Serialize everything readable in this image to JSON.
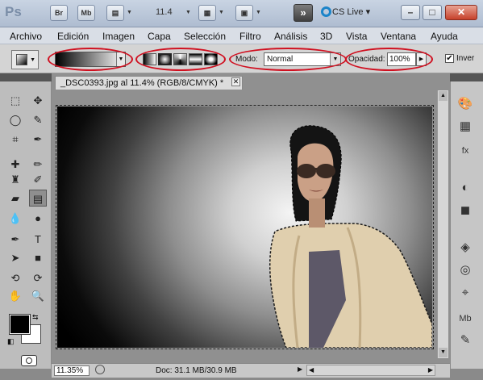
{
  "titlebar": {
    "app_logo": "Ps",
    "bridge_label": "Br",
    "minibridge_label": "Mb",
    "zoom_value": "11.4",
    "extensions_label": "»",
    "cslive_label": "CS Live",
    "cslive_arrow": "▾",
    "minimize_glyph": "–",
    "restore_glyph": "□",
    "close_glyph": "✕"
  },
  "menu": {
    "items": [
      "Archivo",
      "Edición",
      "Imagen",
      "Capa",
      "Selección",
      "Filtro",
      "Análisis",
      "3D",
      "Vista",
      "Ventana",
      "Ayuda"
    ]
  },
  "options": {
    "gradient_types": [
      "lineal",
      "radial",
      "angular",
      "reflejado",
      "diamante"
    ],
    "selected_gradient_type": "radial",
    "mode_label": "Modo:",
    "mode_value": "Normal",
    "opacity_label": "Opacidad:",
    "opacity_value": "100%",
    "invert_checked": true,
    "invert_label": "Inver"
  },
  "document": {
    "tab_title": "_DSC0393.jpg al 11.4% (RGB/8/CMYK) *",
    "close_glyph": "✕"
  },
  "status": {
    "zoom": "11.35%",
    "doc_info": "Doc: 31.1 MB/30.9 MB"
  },
  "colors": {
    "foreground": "#000000",
    "background": "#ffffff",
    "highlight_ring": "#d01020"
  },
  "tools": [
    "marquee-icon",
    "move-icon",
    "lasso-icon",
    "quick-select-icon",
    "crop-icon",
    "eyedropper-icon",
    "healing-icon",
    "brush-icon",
    "clone-stamp-icon",
    "history-brush-icon",
    "eraser-icon",
    "gradient-icon",
    "blur-icon",
    "dodge-icon",
    "pen-icon",
    "type-icon",
    "path-select-icon",
    "shape-icon",
    "3d-rotate-icon",
    "3d-orbit-icon",
    "hand-icon",
    "zoom-icon"
  ],
  "right_panels": [
    "color-icon",
    "swatches-icon",
    "styles-icon",
    "adjustments-icon",
    "masks-icon",
    "layers-icon",
    "channels-icon",
    "paths-icon",
    "minibridge-icon",
    "notes-icon"
  ]
}
